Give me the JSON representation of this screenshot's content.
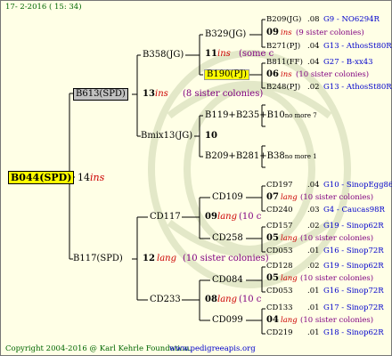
{
  "header": {
    "date_stamp": "17- 2-2016 ( 15: 34)"
  },
  "root": {
    "name": "B044(SPD)",
    "gen": "14",
    "tag": "ins"
  },
  "father": {
    "name": "B613(SPD)",
    "gen": "13",
    "tag": "ins",
    "note": "(8 sister colonies)"
  },
  "mother": {
    "name": "B117(SPD)",
    "gen": "12",
    "tag": "lang",
    "note": "(10 sister colonies)"
  },
  "b358": {
    "name": "B358(JG)"
  },
  "bmix": {
    "name": "Bmix13(JG)",
    "gen": "10"
  },
  "b329": {
    "name": "B329(JG)",
    "gen": "11",
    "tag": "ins",
    "note": "(some c"
  },
  "b190": {
    "name": "B190(PJ)"
  },
  "b119": {
    "name": "B119+B235+B10",
    "nm": "no more 7"
  },
  "b209b": {
    "name": "B209+B281+B38",
    "nm": "no more 1"
  },
  "cd117": {
    "name": "CD117",
    "gen": "09",
    "tag": "lang",
    "note": "(10 c"
  },
  "cd233": {
    "name": "CD233",
    "gen": "08",
    "tag": "lang",
    "note": "(10 c"
  },
  "cd109": {
    "name": "CD109"
  },
  "cd258": {
    "name": "CD258"
  },
  "cd084": {
    "name": "CD084"
  },
  "cd099": {
    "name": "CD099"
  },
  "gen4": [
    {
      "name": "B209(JG)",
      "score": ".08",
      "link": "G9 - NO6294R"
    },
    {
      "gen": "09",
      "tag": "ins",
      "note": "(9 sister colonies)"
    },
    {
      "name": "B271(PJ)",
      "score": ".04",
      "link": "G13 - AthosSt80R"
    },
    {
      "name": "B811(FF)",
      "score": ".04",
      "link": "G27 - B-xx43"
    },
    {
      "gen": "06",
      "tag": "ins",
      "note": "(10 sister colonies)"
    },
    {
      "name": "B248(PJ)",
      "score": ".02",
      "link": "G13 - AthosSt80R"
    },
    {
      "name": "CD197",
      "score": ".04",
      "link": "G10 - SinopEgg86R"
    },
    {
      "gen": "07",
      "tag": "lang",
      "note": "(10 sister colonies)"
    },
    {
      "name": "CD240",
      "score": ".03",
      "link": "G4 - Caucas98R"
    },
    {
      "name": "CD157",
      "score": ".02",
      "link": "G19 - Sinop62R"
    },
    {
      "gen": "05",
      "tag": "lang",
      "note": "(10 sister colonies)"
    },
    {
      "name": "CD053",
      "score": ".01",
      "link": "G16 - Sinop72R"
    },
    {
      "name": "CD128",
      "score": ".02",
      "link": "G19 - Sinop62R"
    },
    {
      "gen": "05",
      "tag": "lang",
      "note": "(10 sister colonies)"
    },
    {
      "name": "CD053",
      "score": ".01",
      "link": "G16 - Sinop72R"
    },
    {
      "name": "CD133",
      "score": ".01",
      "link": "G17 - Sinop72R"
    },
    {
      "gen": "04",
      "tag": "lang",
      "note": "(10 sister colonies)"
    },
    {
      "name": "CD219",
      "score": ".01",
      "link": "G18 - Sinop62R"
    }
  ],
  "footer": {
    "copyright": "Copyright 2004-2016 @ Karl Kehrle Foundation.",
    "url": "www.pedigreeapis.org"
  }
}
